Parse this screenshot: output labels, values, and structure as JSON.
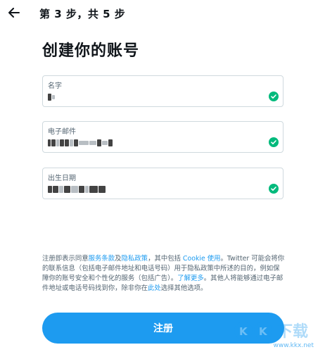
{
  "header": {
    "step_text": "第 3 步，共 5 步"
  },
  "page": {
    "title": "创建你的账号"
  },
  "form": {
    "name": {
      "label": "名字",
      "value": ""
    },
    "email": {
      "label": "电子邮件",
      "value": ""
    },
    "birthday": {
      "label": "出生日期",
      "value": ""
    }
  },
  "terms": {
    "t1": "注册即表示同意",
    "terms_link": "服务条款",
    "t2": "及",
    "privacy_link": "隐私政策",
    "t3": "，其中包括 ",
    "cookie_link": "Cookie 使用",
    "t4": "。Twitter 可能会将你的联系信息（包括电子邮件地址和电话号码）用于隐私政策中所述的目的，例如保障你的账号安全和个性化的服务（包括广告）。",
    "learn_more_link": "了解更多",
    "t5": "。其他人将能够通过电子邮件地址或电话号码找到你，除非你在",
    "here_link": "此处",
    "t6": "选择其他选项。"
  },
  "buttons": {
    "signup": "注册"
  },
  "watermark": {
    "text": "www.kkx.net"
  },
  "colors": {
    "accent": "#1d9bf0",
    "check": "#00ba7c",
    "text": "#0f1419",
    "muted": "#536471"
  },
  "icons": {
    "back": "arrow-left-icon",
    "valid": "check-circle-icon"
  }
}
